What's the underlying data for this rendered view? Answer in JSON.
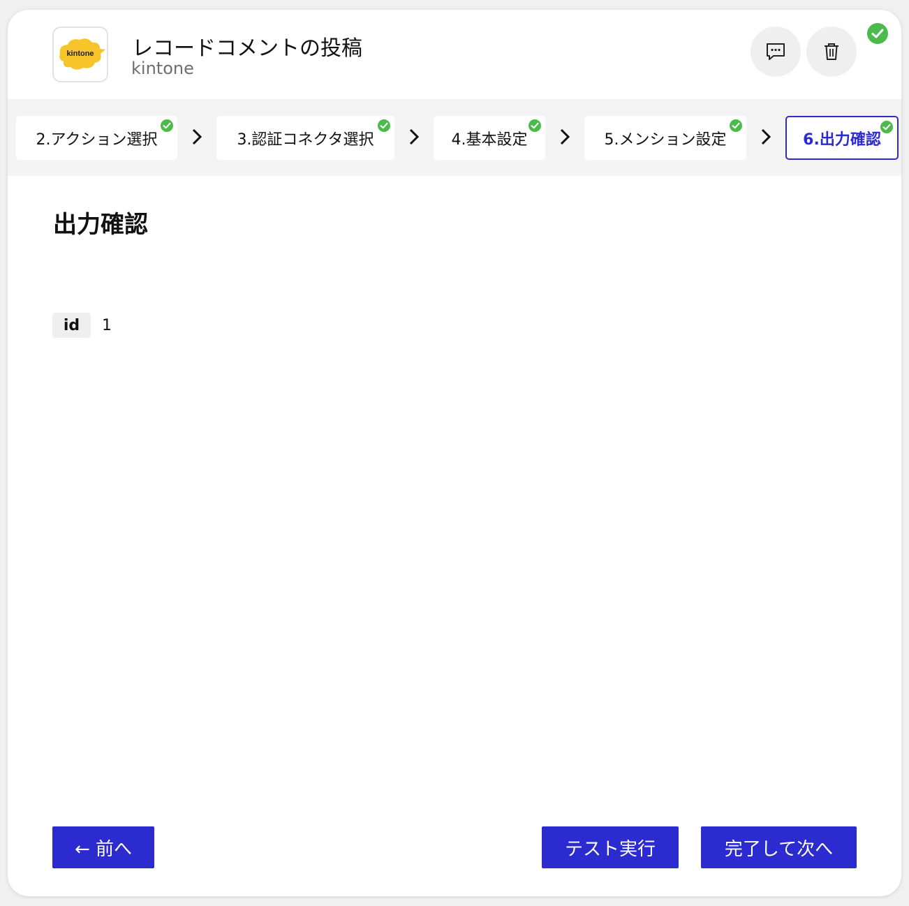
{
  "header": {
    "title": "レコードコメントの投稿",
    "subtitle": "kintone",
    "logo_text": "kintone",
    "status_color": "#4cbb4c"
  },
  "steps": [
    {
      "label": "2.アクション選択",
      "done": true,
      "active": false
    },
    {
      "label": "3.認証コネクタ選択",
      "done": true,
      "active": false
    },
    {
      "label": "4.基本設定",
      "done": true,
      "active": false
    },
    {
      "label": "5.メンション設定",
      "done": true,
      "active": false
    },
    {
      "label": "6.出力確認",
      "done": true,
      "active": true
    }
  ],
  "content": {
    "section_title": "出力確認",
    "output": [
      {
        "key": "id",
        "value": "1"
      }
    ]
  },
  "footer": {
    "prev_label": "← 前へ",
    "test_label": "テスト実行",
    "next_label": "完了して次へ"
  },
  "colors": {
    "accent": "#2b2bd0",
    "success": "#4cbb4c",
    "logo_yellow": "#f8c42b"
  }
}
